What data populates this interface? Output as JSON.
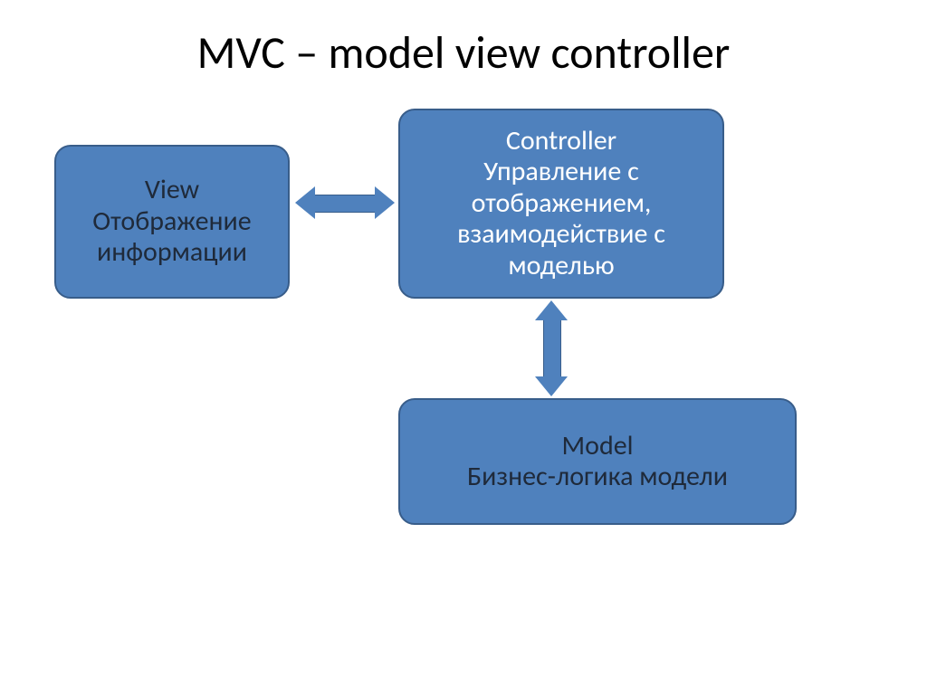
{
  "title": "MVC – model view controller",
  "nodes": {
    "view": {
      "label1": "View",
      "label2": "Отображение информации"
    },
    "controller": {
      "label1": "Controller",
      "label2": "Управление с отображением, взаимодействие с моделью"
    },
    "model": {
      "label1": "Model",
      "label2": "Бизнес-логика модели"
    }
  },
  "edges": [
    {
      "from": "view",
      "to": "controller",
      "bidirectional": true
    },
    {
      "from": "controller",
      "to": "model",
      "bidirectional": true
    }
  ],
  "colors": {
    "box_fill": "#4f81bd",
    "box_border": "#385d8a",
    "text_dark": "#1f2a3a",
    "text_light": "#ffffff"
  }
}
